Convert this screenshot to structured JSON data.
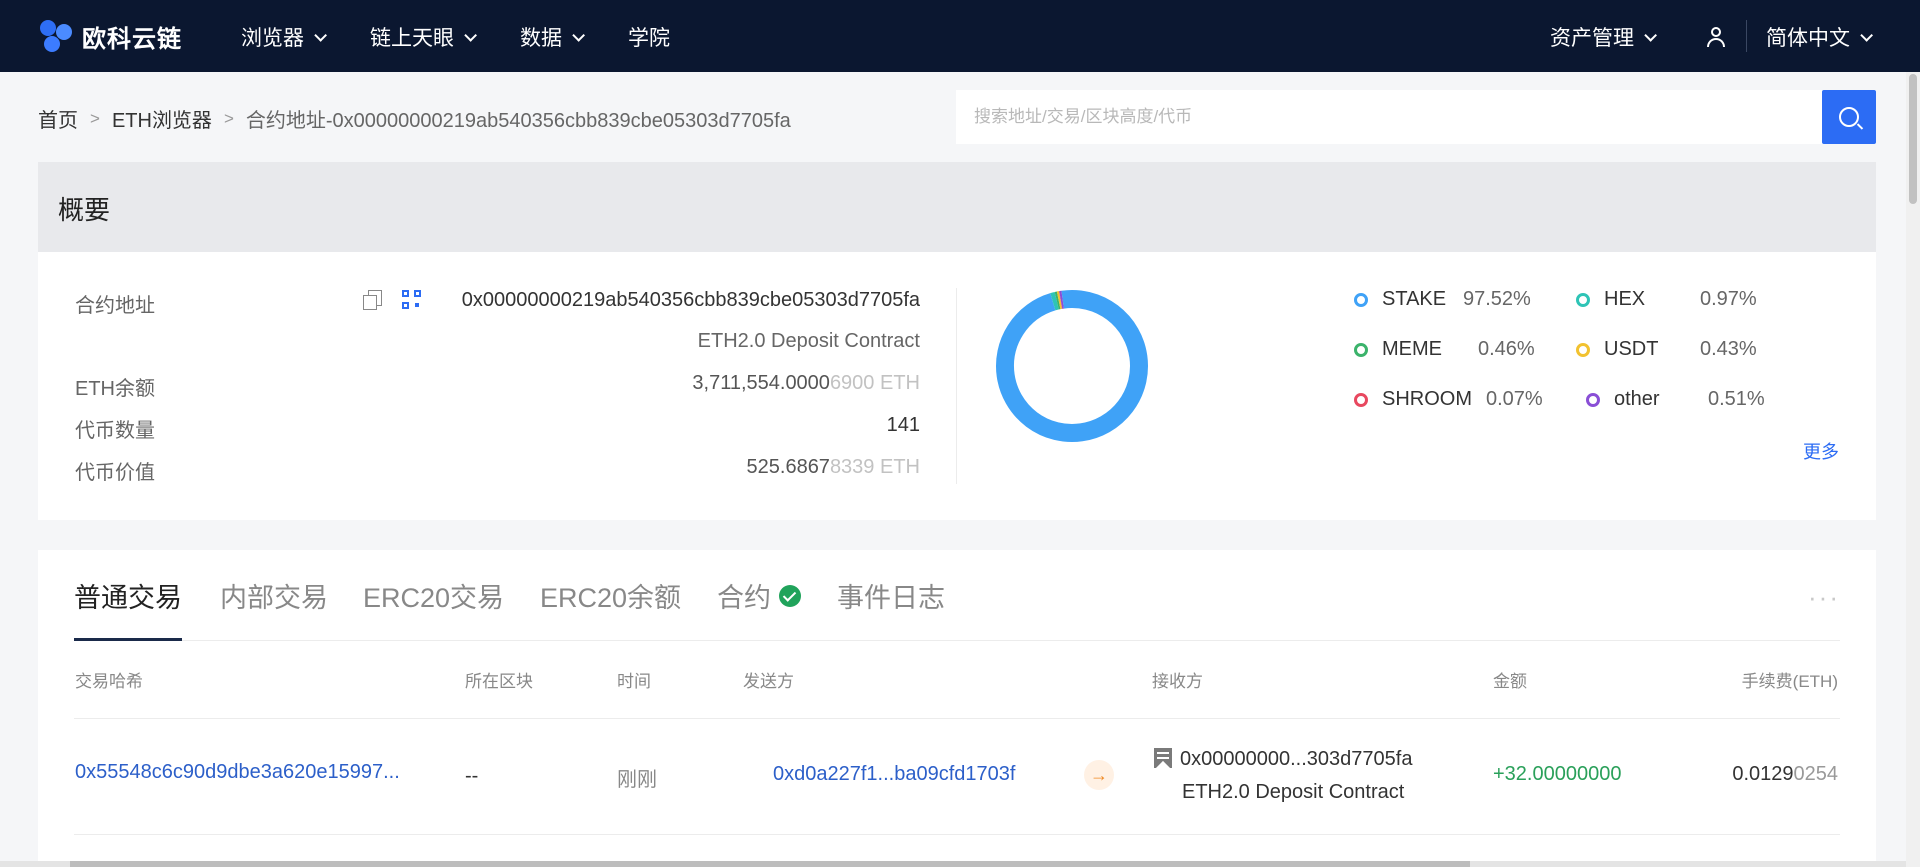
{
  "nav": {
    "logo_text": "欧科云链",
    "items": [
      {
        "label": "浏览器",
        "has_menu": true
      },
      {
        "label": "链上天眼",
        "has_menu": true
      },
      {
        "label": "数据",
        "has_menu": true
      },
      {
        "label": "学院",
        "has_menu": false
      }
    ],
    "asset_mgmt": "资产管理",
    "language": "简体中文"
  },
  "breadcrumb": {
    "home": "首页",
    "sep": ">",
    "explorer": "ETH浏览器",
    "current": "合约地址-0x00000000219ab540356cbb839cbe05303d7705fa"
  },
  "search": {
    "placeholder": "搜索地址/交易/区块高度/代币"
  },
  "overview": {
    "title": "概要",
    "contract_label": "合约地址",
    "contract_address": "0x00000000219ab540356cbb839cbe05303d7705fa",
    "contract_name": "ETH2.0 Deposit Contract",
    "balance_label": "ETH余额",
    "balance_main": "3,711,554.0000",
    "balance_dim": "6900 ETH",
    "token_count_label": "代币数量",
    "token_count": "141",
    "token_value_label": "代币价值",
    "token_value_main": "525.6867",
    "token_value_dim": "8339 ETH",
    "more": "更多"
  },
  "chart_data": {
    "type": "pie",
    "categories": [
      "STAKE",
      "HEX",
      "MEME",
      "USDT",
      "SHROOM",
      "other"
    ],
    "values": [
      97.52,
      0.97,
      0.46,
      0.43,
      0.07,
      0.51
    ],
    "labels": [
      "97.52%",
      "0.97%",
      "0.46%",
      "0.43%",
      "0.07%",
      "0.51%"
    ],
    "colors": [
      "#3fa2f7",
      "#2ec4b6",
      "#3bb36b",
      "#f2c230",
      "#e8485f",
      "#8a4fd6"
    ]
  },
  "tabs": [
    {
      "label": "普通交易",
      "active": true
    },
    {
      "label": "内部交易",
      "active": false
    },
    {
      "label": "ERC20交易",
      "active": false
    },
    {
      "label": "ERC20余额",
      "active": false
    },
    {
      "label": "合约",
      "active": false,
      "verified": true
    },
    {
      "label": "事件日志",
      "active": false
    }
  ],
  "more_dots": "···",
  "table": {
    "headers": [
      "交易哈希",
      "所在区块",
      "时间",
      "发送方",
      "接收方",
      "金额",
      "手续费(ETH)"
    ],
    "rows": [
      {
        "hash": "0x55548c6c90d9dbe3a620e15997...",
        "block": "--",
        "time": "刚刚",
        "from": "0xd0a227f1...ba09cfd1703f",
        "to": "0x00000000...303d7705fa",
        "to_name": "ETH2.0 Deposit Contract",
        "amount": "+32.00000000",
        "fee_main": "0.0129",
        "fee_dim": "0254"
      }
    ]
  }
}
